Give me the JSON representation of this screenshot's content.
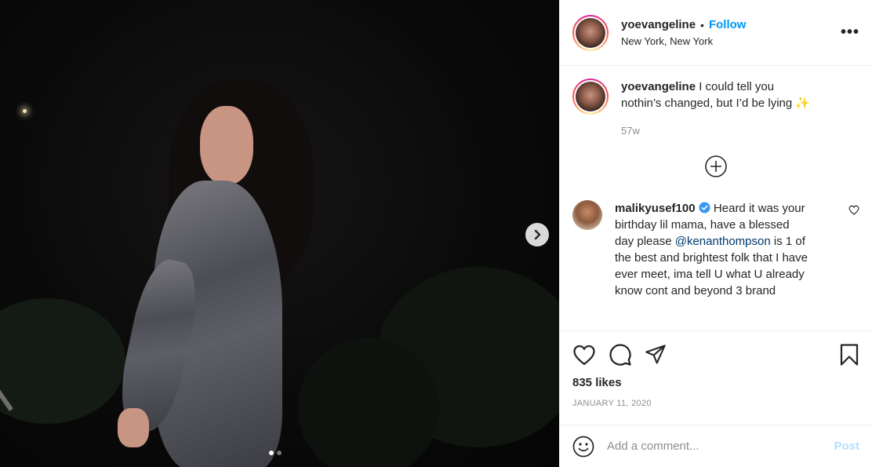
{
  "post": {
    "username": "yoevangeline",
    "follow_label": "Follow",
    "bullet": "•",
    "location": "New York, New York",
    "more_label": "•••"
  },
  "caption": {
    "username": "yoevangeline",
    "text": "I could tell you nothin’s changed, but I’d be lying ✨",
    "time": "57w"
  },
  "comment": {
    "username": "malikyusef100",
    "text_before": "Heard it was your birthday lil mama, have a blessed day please",
    "mention": "@kenanthompson",
    "text_after": "is 1 of the best and brightest folk that I have ever meet, ima tell U what U already know cont and beyond 3 brand"
  },
  "likes": "835 likes",
  "date": "JANUARY 11, 2020",
  "add_comment": {
    "placeholder": "Add a comment...",
    "post_label": "Post"
  },
  "carousel": {
    "slides": 2,
    "active": 1
  },
  "icons": {
    "next": "chevron-right-icon",
    "load_more": "plus-circle-icon",
    "like": "heart-icon",
    "comment": "comment-icon",
    "share": "paper-plane-icon",
    "save": "bookmark-icon",
    "emoji": "smiley-icon",
    "verified": "verified-badge-icon"
  },
  "colors": {
    "accent": "#0095f6",
    "post_disabled": "#b2dffc",
    "verified": "#3897f0"
  }
}
